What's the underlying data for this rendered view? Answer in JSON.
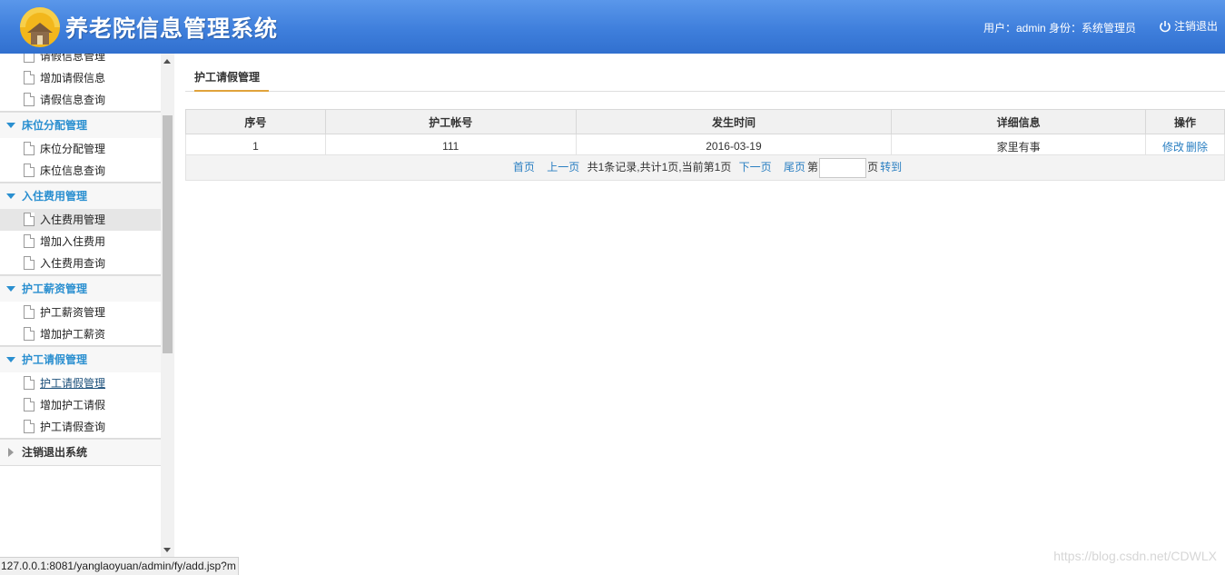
{
  "header": {
    "app_title": "养老院信息管理系统",
    "user_info": "用户：admin 身份：系统管理员",
    "logout_label": "注销退出"
  },
  "sidebar": {
    "top_items": [
      {
        "label": "请假信息管理"
      },
      {
        "label": "增加请假信息"
      },
      {
        "label": "请假信息查询"
      }
    ],
    "groups": [
      {
        "title": "床位分配管理",
        "items": [
          {
            "label": "床位分配管理"
          },
          {
            "label": "床位信息查询"
          }
        ]
      },
      {
        "title": "入住费用管理",
        "items": [
          {
            "label": "入住费用管理"
          },
          {
            "label": "增加入住费用"
          },
          {
            "label": "入住费用查询"
          }
        ]
      },
      {
        "title": "护工薪资管理",
        "items": [
          {
            "label": "护工薪资管理"
          },
          {
            "label": "增加护工薪资"
          }
        ]
      },
      {
        "title": "护工请假管理",
        "items": [
          {
            "label": "护工请假管理"
          },
          {
            "label": "增加护工请假"
          },
          {
            "label": "护工请假查询"
          }
        ]
      }
    ],
    "exit_label": "注销退出系统"
  },
  "main": {
    "tab_label": "护工请假管理",
    "table": {
      "headers": [
        "序号",
        "护工帐号",
        "发生时间",
        "详细信息",
        "操作"
      ],
      "rows": [
        {
          "no": "1",
          "account": "111",
          "date": "2016-03-19",
          "detail": "家里有事",
          "edit": "修改",
          "delete": "删除"
        }
      ]
    },
    "pager": {
      "first": "首页",
      "prev": "上一页",
      "summary": "共1条记录,共计1页,当前第1页",
      "next": "下一页",
      "last": "尾页",
      "page_prefix": "第",
      "page_input_value": "",
      "page_suffix": "页",
      "goto": "转到"
    }
  },
  "status_bar": {
    "url": "127.0.0.1:8081/yanglaoyuan/admin/fy/add.jsp?m"
  },
  "watermark": "https://blog.csdn.net/CDWLX",
  "colors": {
    "header": "#3f7fdc",
    "accent": "#2a8fd0",
    "tab_underline": "#e0a33b"
  }
}
